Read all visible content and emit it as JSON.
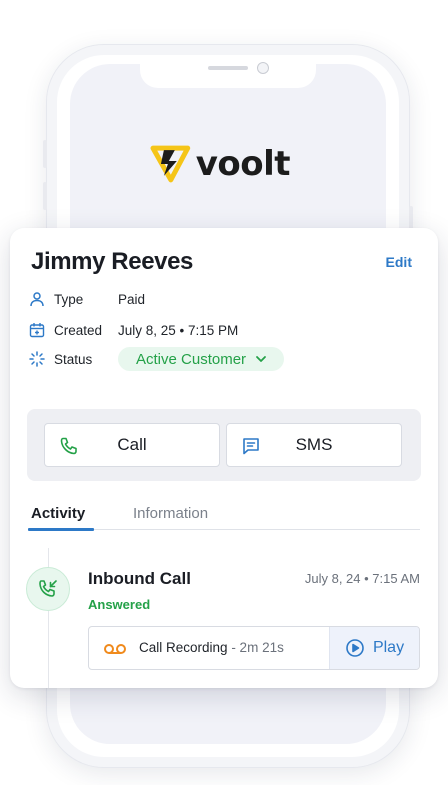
{
  "brand": {
    "logo_text": "voolt",
    "accent": "#f5c518"
  },
  "contact": {
    "name": "Jimmy Reeves",
    "edit_label": "Edit",
    "fields": {
      "type": {
        "label": "Type",
        "value": "Paid",
        "icon": "user-icon"
      },
      "created": {
        "label": "Created",
        "value": "July 8, 25 • 7:15 PM",
        "icon": "calendar-add-icon"
      },
      "status": {
        "label": "Status",
        "value": "Active Customer",
        "icon": "loading-status-icon"
      }
    }
  },
  "actions": {
    "call": {
      "label": "Call",
      "icon": "phone-icon"
    },
    "sms": {
      "label": "SMS",
      "icon": "message-icon"
    }
  },
  "tabs": [
    {
      "label": "Activity",
      "active": true
    },
    {
      "label": "Information",
      "active": false
    }
  ],
  "activity": {
    "title": "Inbound Call",
    "status": "Answered",
    "time": "July 8, 24 • 7:15 AM",
    "icon": "incoming-call-icon",
    "recording": {
      "label": "Call Recording",
      "duration": "- 2m 21s",
      "play_label": "Play",
      "icon": "voicemail-icon"
    }
  },
  "colors": {
    "primary_blue": "#2d79c7",
    "success_green": "#24a148",
    "recording_orange": "#f08a1c"
  }
}
